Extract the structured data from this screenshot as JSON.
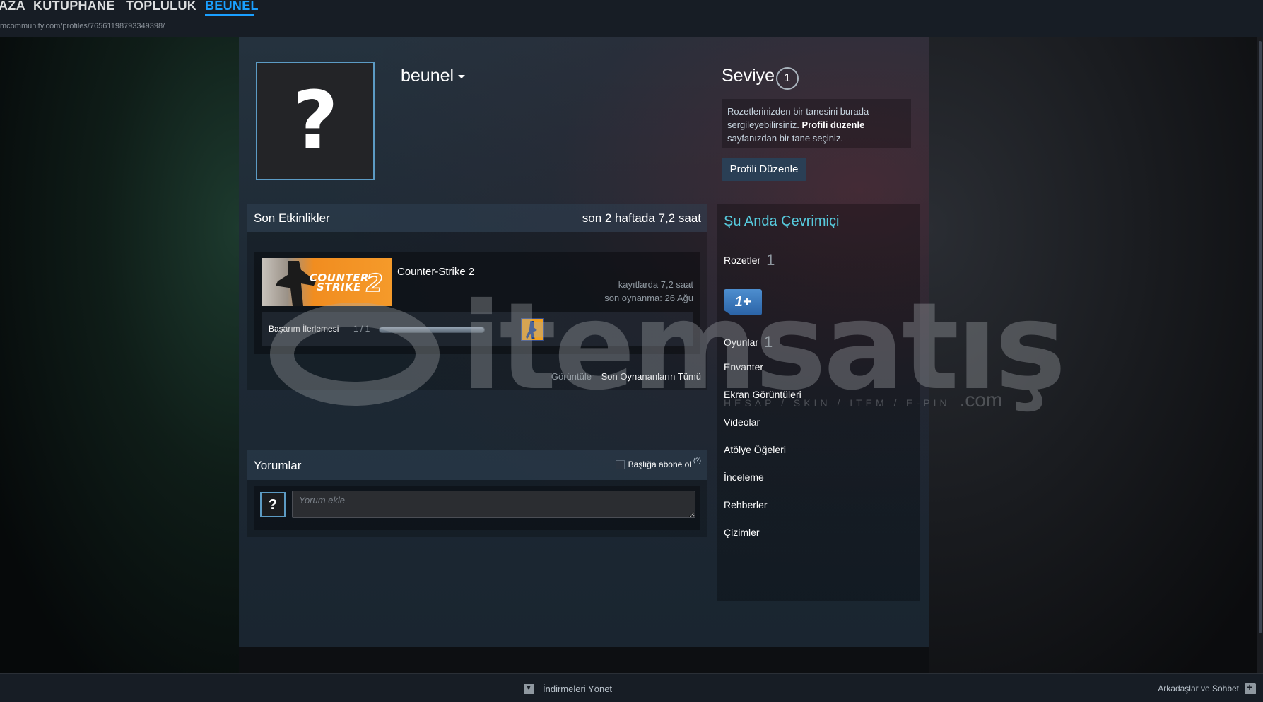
{
  "nav": {
    "items": [
      {
        "label": "AZA",
        "active": false
      },
      {
        "label": "KÜTÜPHANE",
        "active": false
      },
      {
        "label": "TOPLULUK",
        "active": false
      },
      {
        "label": "BEUNEL",
        "active": true
      }
    ],
    "url": "mcommunity.com/profiles/76561198793349398/"
  },
  "profile": {
    "avatar_glyph": "?",
    "username": "beunel",
    "level_label": "Seviye",
    "level_value": "1",
    "badge_info_pre": "Rozetlerinizden bir tanesini burada sergileyebilirsiniz.",
    "badge_info_link": "Profili düzenle",
    "badge_info_post": "sayfanızdan bir tane seçiniz.",
    "edit_button": "Profili Düzenle"
  },
  "recent": {
    "title": "Son Etkinlikler",
    "hours": "son 2 haftada 7,2 saat",
    "game": {
      "name": "Counter-Strike 2",
      "capsule_logo_line1": "COUNTER",
      "capsule_logo_line2": "STRIKE",
      "capsule_logo_num": "2",
      "hours_on_record": "kayıtlarda 7,2 saat",
      "last_played": "son oynanma: 26 Ağu",
      "achievement_label": "Başarım İlerlemesi",
      "achievement_count": "1 / 1",
      "achievement_progress": 1.0
    },
    "view_label": "Görüntüle",
    "view_link": "Son Oynananların Tümü"
  },
  "comments": {
    "title": "Yorumlar",
    "subscribe_label": "Başlığa abone ol",
    "help": "(?)",
    "avatar_glyph": "?",
    "input_placeholder": "Yorum ekle"
  },
  "sidebar": {
    "status": "Şu Anda Çevrimiçi",
    "badges_label": "Rozetler",
    "badges_count": "1",
    "badge_icon_text": "1+",
    "games_label": "Oyunlar",
    "games_count": "1",
    "links": [
      "Envanter",
      "Ekran Görüntüleri",
      "Videolar",
      "Atölye Öğeleri",
      "İnceleme",
      "Rehberler",
      "Çizimler"
    ]
  },
  "watermark": {
    "text": "itemsatış",
    "sub": "HESAP / SKIN / ITEM / E-PIN",
    "domain": ".com"
  },
  "bottom": {
    "downloads": "İndirmeleri Yönet",
    "friends": "Arkadaşlar ve Sohbet"
  },
  "colors": {
    "accent": "#1a9fff",
    "online": "#57cbde",
    "nav_bg": "#171d25"
  }
}
